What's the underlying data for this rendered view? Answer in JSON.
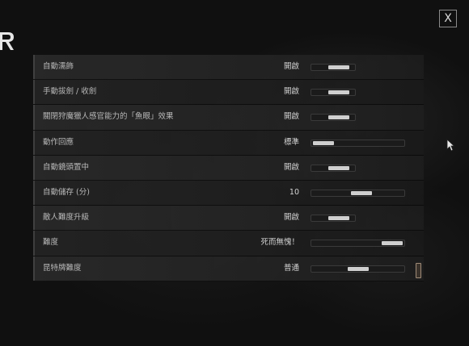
{
  "close_button": {
    "label": "X"
  },
  "settings": [
    {
      "label": "自動濡飾",
      "value": "開啟",
      "control": "toggle",
      "level": 0.8
    },
    {
      "label": "手動拔劍 / 收劍",
      "value": "開啟",
      "control": "toggle",
      "level": 0.8
    },
    {
      "label": "關閉狩魔獵人感官能力的「魚眼」效果",
      "value": "開啟",
      "control": "toggle",
      "level": 0.8
    },
    {
      "label": "動作回應",
      "value": "標準",
      "control": "slider",
      "level": 0.0
    },
    {
      "label": "自動鏡頭置中",
      "value": "開啟",
      "control": "toggle",
      "level": 0.8
    },
    {
      "label": "自動儲存 (分)",
      "value": "10",
      "control": "slider",
      "level": 0.55
    },
    {
      "label": "敵人難度升級",
      "value": "開啟",
      "control": "toggle",
      "level": 0.8
    },
    {
      "label": "難度",
      "value": "死而無愧！",
      "control": "slider",
      "level": 1.0
    },
    {
      "label": "昆特牌難度",
      "value": "普通",
      "control": "slider",
      "level": 0.5
    }
  ]
}
